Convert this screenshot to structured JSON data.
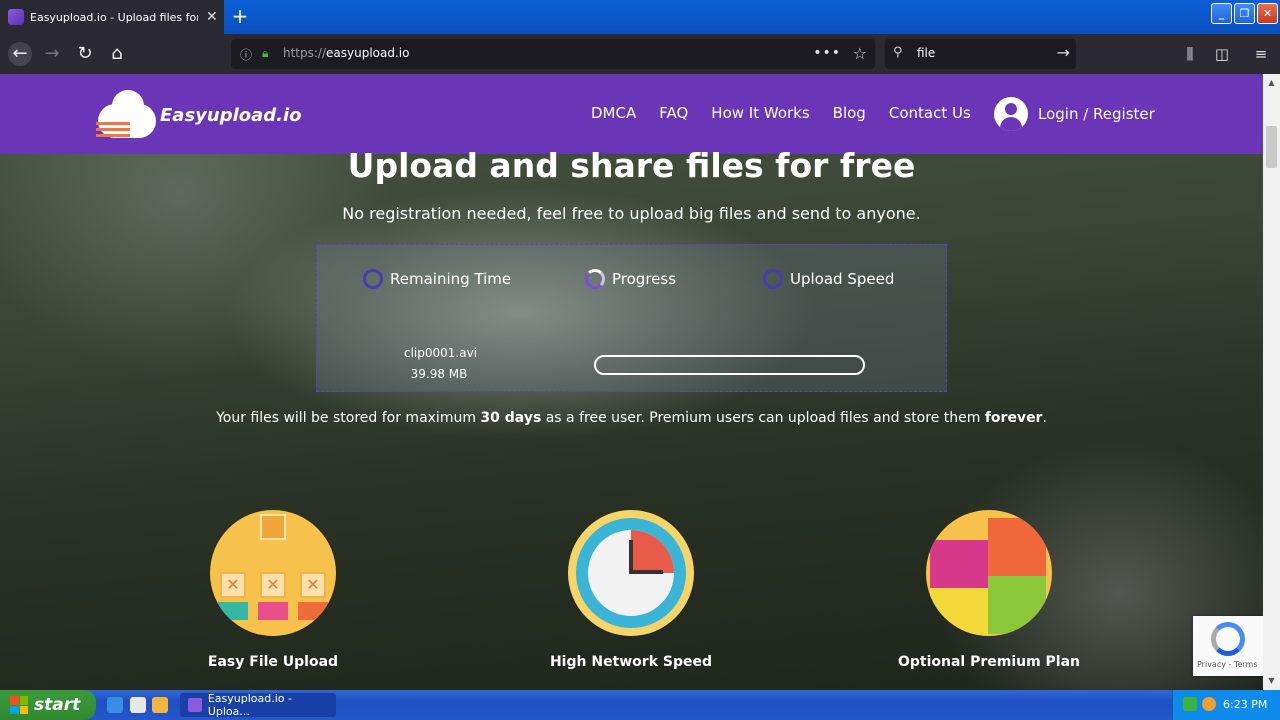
{
  "browser": {
    "tab_title": "Easyupload.io - Upload files for fr",
    "url_prefix": "https://",
    "url_host": "easyupload.io",
    "search_query": "file"
  },
  "site": {
    "logo_text": "Easyupload.io",
    "nav": [
      "DMCA",
      "FAQ",
      "How It Works",
      "Blog",
      "Contact Us"
    ],
    "login_label": "Login / Register",
    "brand_color": "#6a35b7"
  },
  "hero": {
    "title": "Upload and share files for free",
    "subtitle": "No registration needed, feel free to upload big files and send to anyone."
  },
  "upload": {
    "stats": [
      "Remaining Time",
      "Progress",
      "Upload Speed"
    ],
    "file_name": "clip0001.avi",
    "file_size": "39.98 MB",
    "progress": 0
  },
  "storage_note": {
    "part1": "Your files will be stored for maximum ",
    "days": "30 days",
    "part2": " as a free user. Premium users can upload files and store them ",
    "forever": "forever",
    "part3": "."
  },
  "features": [
    "Easy File Upload",
    "High Network Speed",
    "Optional Premium Plan"
  ],
  "recaptcha": {
    "terms": "Privacy - Terms"
  },
  "taskbar": {
    "start_label": "start",
    "task_label": "Easyupload.io - Uploa...",
    "clock": "6:23 PM"
  }
}
